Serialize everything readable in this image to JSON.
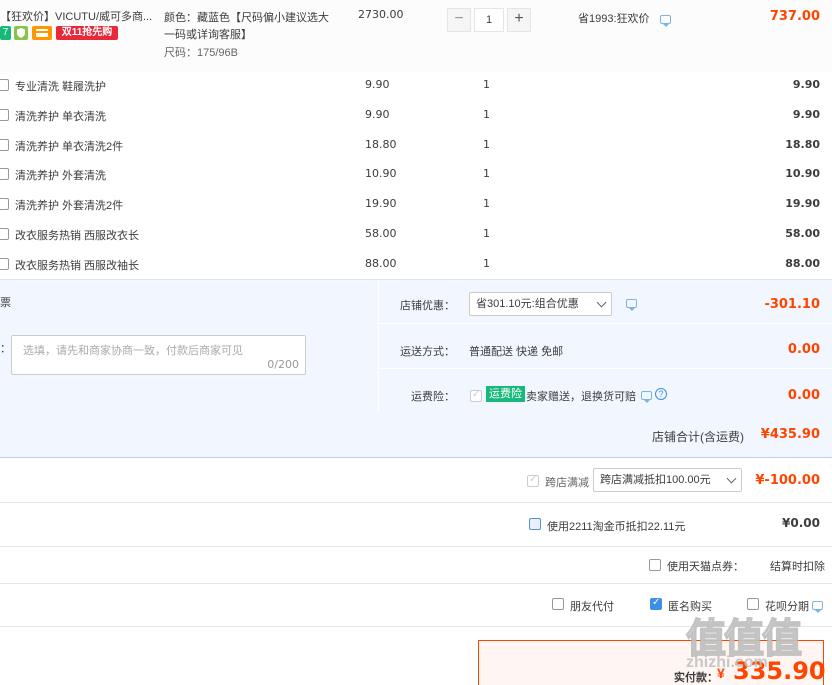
{
  "main_item": {
    "title": "【狂欢价】VICUTU/威可多商...",
    "badges": {
      "badge1": "7",
      "badge3": "",
      "badge4": "双11抢先购"
    },
    "sku_color": "颜色：藏蓝色【尺码偏小建议选大",
    "sku_color2": "一码或详询客服】",
    "sku_size": "尺码：175/96B",
    "unit_price": "2730.00",
    "qty": "1",
    "minus": "−",
    "plus": "+",
    "saving": "省1993:狂欢价",
    "total": "737.00"
  },
  "services": [
    {
      "name": "专业清洗 鞋履洗护",
      "price": "9.90",
      "qty": "1",
      "total": "9.90"
    },
    {
      "name": "清洗养护 单衣清洗",
      "price": "9.90",
      "qty": "1",
      "total": "9.90"
    },
    {
      "name": "清洗养护 单衣清洗2件",
      "price": "18.80",
      "qty": "1",
      "total": "18.80"
    },
    {
      "name": "清洗养护 外套清洗",
      "price": "10.90",
      "qty": "1",
      "total": "10.90"
    },
    {
      "name": "清洗养护 外套清洗2件",
      "price": "19.90",
      "qty": "1",
      "total": "19.90"
    },
    {
      "name": "改衣服务热销 西服改衣长",
      "price": "58.00",
      "qty": "1",
      "total": "58.00"
    },
    {
      "name": "改衣服务热销 西服改袖长",
      "price": "88.00",
      "qty": "1",
      "total": "88.00"
    }
  ],
  "shop": {
    "invoice_label": "票",
    "message_label": "：",
    "message_placeholder": "选填，请先和商家协商一致，付款后商家可见",
    "message_count": "0/200",
    "discount_label": "店铺优惠：",
    "discount_value": "省301.10元:组合优惠",
    "discount_amount": "-301.10",
    "shipping_label": "运送方式：",
    "shipping_value": "普通配送 快递 免邮",
    "shipping_amount": "0.00",
    "insurance_label": "运费险：",
    "insurance_tag": "运费险",
    "insurance_value": "卖家赠送，退换货可赔",
    "insurance_amount": "0.00",
    "help": "?",
    "subtotal_label": "店铺合计(含运费)",
    "subtotal_value": "¥435.90"
  },
  "cross_store": {
    "label": "跨店满减",
    "value": "跨店满减抵扣100.00元",
    "amount": "¥-100.00"
  },
  "taobao_coin": {
    "label": "使用2211淘金币抵扣22.11元",
    "amount": "¥0.00"
  },
  "tmall_points": {
    "label": "使用天猫点券：",
    "value": "结算时扣除"
  },
  "pay_options": {
    "friend": "朋友代付",
    "anonymous": "匿名购买",
    "huabei": "花呗分期"
  },
  "final": {
    "label": "实付款：",
    "currency": "¥",
    "amount": "335.90"
  },
  "watermark": {
    "logo": "值值值",
    "site": "zhizhi.com"
  },
  "colors": {
    "accent": "#ff4400",
    "panel_bg": "#f2f7ff",
    "badge_green": "#17b978",
    "badge_orange": "#ff9800",
    "badge_red": "#e9283a"
  }
}
